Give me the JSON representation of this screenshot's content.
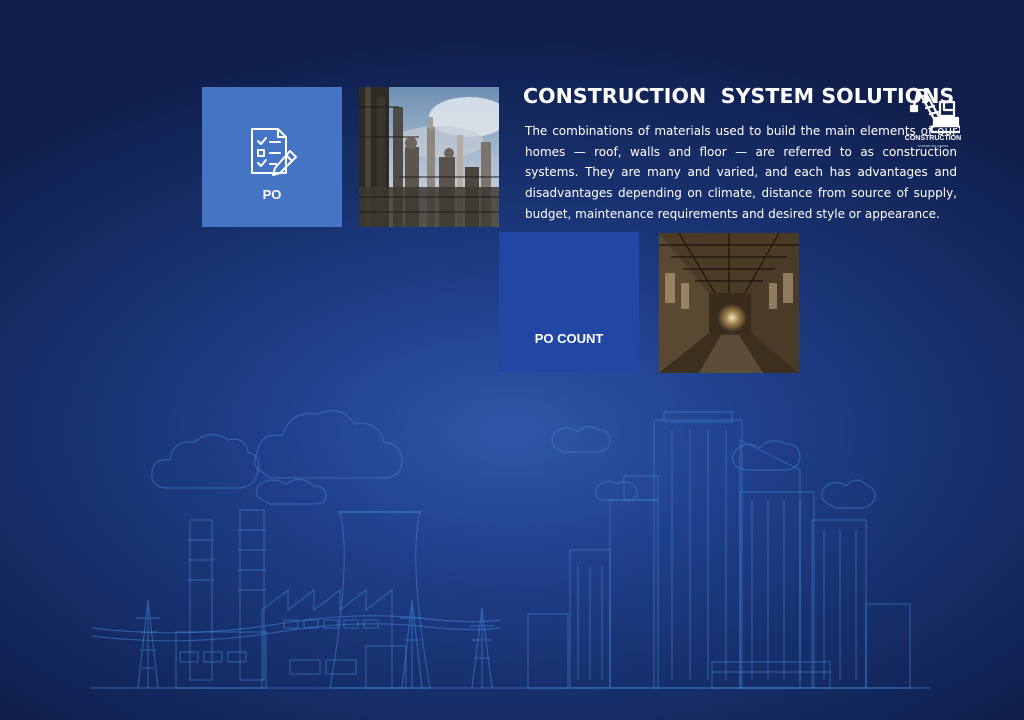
{
  "tiles": {
    "po": {
      "label": "PO",
      "icon": "purchase-order-icon"
    },
    "po_count": {
      "label": "PO COUNT"
    }
  },
  "info": {
    "title": "CONSTRUCTION  SYSTEM SOLUTIONS",
    "description": "The combinations of materials used to build the main elements of our homes — roof, walls and floor — are referred to as construction systems. They are many and varied, and each has advantages and disadvantages depending on climate, distance from source of supply, budget, maintenance requirements and desired style or appearance."
  },
  "logo": {
    "brand": "CONSTRUCTION",
    "tagline": "SYSTEM SOLUTIONS",
    "icon": "crane-icon"
  },
  "images": {
    "refinery": "industrial-refinery-photo",
    "hall": "abandoned-factory-hall-photo"
  },
  "colors": {
    "background_dark": "#101f4d",
    "background_mid": "#2f57a8",
    "tile_po": "#4574c4",
    "tile_po_count": "#2146a3",
    "outline_art": "#3d7fd0"
  }
}
